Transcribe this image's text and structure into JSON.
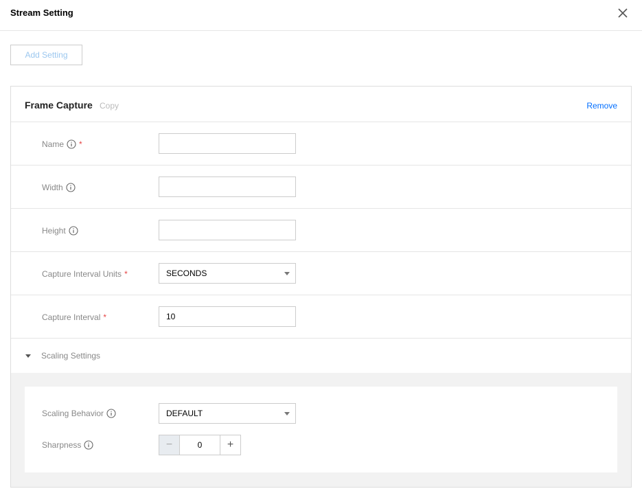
{
  "dialog": {
    "title": "Stream Setting"
  },
  "toolbar": {
    "add_label": "Add Setting"
  },
  "card": {
    "title": "Frame Capture",
    "copy_label": "Copy",
    "remove_label": "Remove",
    "fields": [
      {
        "label": "Name",
        "required": "*",
        "value": ""
      },
      {
        "label": "Width",
        "value": ""
      },
      {
        "label": "Height",
        "value": ""
      },
      {
        "label": "Capture Interval Units",
        "required": "*",
        "value": "SECONDS"
      },
      {
        "label": "Capture Interval",
        "required": "*",
        "value": "10"
      }
    ],
    "scaling": {
      "title": "Scaling Settings",
      "behavior_label": "Scaling Behavior",
      "behavior_value": "DEFAULT",
      "sharpness_label": "Sharpness",
      "sharpness_value": "0",
      "minus": "−",
      "plus": "+"
    }
  },
  "colors": {
    "accent": "#006eff",
    "required": "#e54545",
    "muted_text": "#888888"
  }
}
